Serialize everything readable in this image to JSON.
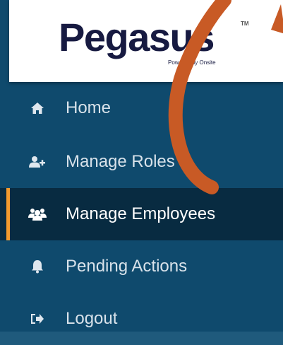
{
  "logo": {
    "title": "Pegasus",
    "tm": "TM",
    "subtitle": "Powered by Onsite"
  },
  "nav": {
    "items": [
      {
        "label": "Home",
        "icon": "home-icon"
      },
      {
        "label": "Manage Roles",
        "icon": "add-user-icon"
      },
      {
        "label": "Manage Employees",
        "icon": "users-icon",
        "active": true
      },
      {
        "label": "Pending Actions",
        "icon": "bell-icon"
      },
      {
        "label": "Logout",
        "icon": "logout-icon"
      }
    ]
  },
  "colors": {
    "sidebar": "#0f4a6d",
    "active_bg": "#082b41",
    "active_accent": "#f29a2e",
    "annotation_arc": "#c85a25"
  }
}
